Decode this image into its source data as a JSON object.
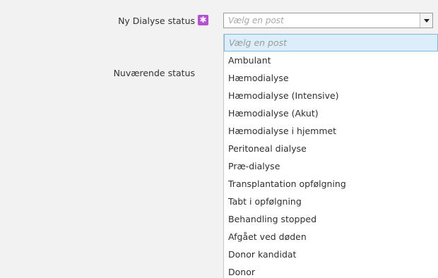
{
  "form": {
    "new_status_label": "Ny Dialyse status",
    "current_status_label": "Nuværende status",
    "required_marker": "✱"
  },
  "select": {
    "value": "Vælg en post"
  },
  "dropdown": {
    "options": [
      "Vælg en post",
      "Ambulant",
      "Hæmodialyse",
      "Hæmodialyse (Intensive)",
      "Hæmodialyse (Akut)",
      "Hæmodialyse i hjemmet",
      "Peritoneal dialyse",
      "Præ-dialyse",
      "Transplantation opfølgning",
      "Tabt i opfølgning",
      "Behandling stopped",
      "Afgået ved døden",
      "Donor kandidat",
      "Donor"
    ]
  }
}
